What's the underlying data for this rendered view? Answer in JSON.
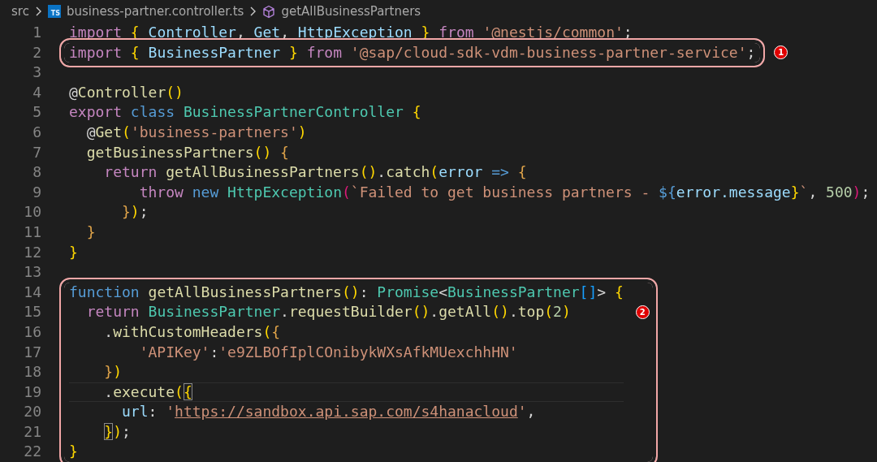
{
  "breadcrumb": [
    {
      "label": "src",
      "kind": "folder"
    },
    {
      "label": "business-partner.controller.ts",
      "kind": "file",
      "icon_text": "TS"
    },
    {
      "label": "getAllBusinessPartners",
      "kind": "symbol"
    }
  ],
  "code_groups": [
    {
      "lines": [
        {
          "number": "1",
          "tokens": [
            {
              "text": "import",
              "kind": "k"
            },
            {
              "text": " {",
              "kind": "b1"
            },
            {
              "text": " Controller",
              "kind": "v"
            },
            {
              "text": ",",
              "kind": "p"
            },
            {
              "text": " Get",
              "kind": "v"
            },
            {
              "text": ",",
              "kind": "p"
            },
            {
              "text": " HttpException",
              "kind": "v"
            },
            {
              "text": " }",
              "kind": "b1"
            },
            {
              "text": " from",
              "kind": "k"
            },
            {
              "text": " '@nestjs/common'",
              "kind": "str"
            },
            {
              "text": ";",
              "kind": "p"
            }
          ]
        }
      ]
    },
    {
      "callout": "1",
      "badge_inside": false,
      "lines": [
        {
          "number": "2",
          "tokens": [
            {
              "text": "import",
              "kind": "k"
            },
            {
              "text": " {",
              "kind": "b1"
            },
            {
              "text": " BusinessPartner",
              "kind": "v"
            },
            {
              "text": " }",
              "kind": "b1"
            },
            {
              "text": " from",
              "kind": "k"
            },
            {
              "text": " '@sap/cloud-sdk-vdm-business-partner-service'",
              "kind": "str"
            },
            {
              "text": ";",
              "kind": "p"
            }
          ]
        }
      ]
    },
    {
      "lines": [
        {
          "number": "3"
        },
        {
          "number": "4",
          "tokens": [
            {
              "text": "@",
              "kind": "p"
            },
            {
              "text": "Controller",
              "kind": "f"
            },
            {
              "text": "()",
              "kind": "b1"
            }
          ]
        },
        {
          "number": "5",
          "tokens": [
            {
              "text": "export",
              "kind": "k"
            },
            {
              "text": " class",
              "kind": "s"
            },
            {
              "text": " BusinessPartnerController",
              "kind": "t"
            },
            {
              "text": " {",
              "kind": "b1"
            }
          ]
        },
        {
          "number": "6",
          "tokens": [
            {
              "text": "  @",
              "kind": "p"
            },
            {
              "text": "Get",
              "kind": "f"
            },
            {
              "text": "(",
              "kind": "b1"
            },
            {
              "text": "'business-partners'",
              "kind": "str"
            },
            {
              "text": ")",
              "kind": "b1"
            }
          ]
        },
        {
          "number": "7",
          "tokens": [
            {
              "text": "  getBusinessPartners",
              "kind": "f"
            },
            {
              "text": "()",
              "kind": "b1"
            },
            {
              "text": " {",
              "kind": "b4"
            }
          ]
        },
        {
          "number": "8",
          "tokens": [
            {
              "text": "    return",
              "kind": "k"
            },
            {
              "text": " getAllBusinessPartners",
              "kind": "f"
            },
            {
              "text": "()",
              "kind": "b1"
            },
            {
              "text": ".",
              "kind": "p"
            },
            {
              "text": "catch",
              "kind": "f"
            },
            {
              "text": "(",
              "kind": "b1"
            },
            {
              "text": "error",
              "kind": "v"
            },
            {
              "text": " =>",
              "kind": "s"
            },
            {
              "text": " {",
              "kind": "b4"
            }
          ]
        },
        {
          "number": "9",
          "tokens": [
            {
              "text": "        throw",
              "kind": "k"
            },
            {
              "text": " new",
              "kind": "s"
            },
            {
              "text": " HttpException",
              "kind": "t"
            },
            {
              "text": "(",
              "kind": "b2"
            },
            {
              "text": "`Failed to get business partners - ",
              "kind": "str"
            },
            {
              "text": "${",
              "kind": "s"
            },
            {
              "text": "error.message",
              "kind": "v"
            },
            {
              "text": "}",
              "kind": "b1"
            },
            {
              "text": "`",
              "kind": "str"
            },
            {
              "text": ",",
              "kind": "p"
            },
            {
              "text": " 500",
              "kind": "n"
            },
            {
              "text": ")",
              "kind": "b2"
            },
            {
              "text": ";",
              "kind": "p"
            }
          ]
        },
        {
          "number": "10",
          "tokens": [
            {
              "text": "      }",
              "kind": "b4"
            },
            {
              "text": ")",
              "kind": "b1"
            },
            {
              "text": ";",
              "kind": "p"
            }
          ]
        },
        {
          "number": "11",
          "tokens": [
            {
              "text": "  }",
              "kind": "b4"
            }
          ]
        },
        {
          "number": "12",
          "tokens": [
            {
              "text": "}",
              "kind": "b1"
            }
          ]
        },
        {
          "number": "13"
        }
      ]
    },
    {
      "callout": "2",
      "badge_inside": true,
      "lines": [
        {
          "number": "14",
          "tokens": [
            {
              "text": "function",
              "kind": "s"
            },
            {
              "text": " getAllBusinessPartners",
              "kind": "f"
            },
            {
              "text": "()",
              "kind": "b1"
            },
            {
              "text": ":",
              "kind": "p"
            },
            {
              "text": " Promise",
              "kind": "t"
            },
            {
              "text": "<",
              "kind": "p"
            },
            {
              "text": "BusinessPartner",
              "kind": "t"
            },
            {
              "text": "[]",
              "kind": "b3"
            },
            {
              "text": ">",
              "kind": "p"
            },
            {
              "text": " {",
              "kind": "b1"
            }
          ]
        },
        {
          "number": "15",
          "tokens": [
            {
              "text": "  return",
              "kind": "k"
            },
            {
              "text": " BusinessPartner",
              "kind": "t"
            },
            {
              "text": ".",
              "kind": "p"
            },
            {
              "text": "requestBuilder",
              "kind": "f"
            },
            {
              "text": "()",
              "kind": "b1"
            },
            {
              "text": ".",
              "kind": "p"
            },
            {
              "text": "getAll",
              "kind": "f"
            },
            {
              "text": "()",
              "kind": "b1"
            },
            {
              "text": ".",
              "kind": "p"
            },
            {
              "text": "top",
              "kind": "f"
            },
            {
              "text": "(",
              "kind": "b1"
            },
            {
              "text": "2",
              "kind": "n"
            },
            {
              "text": ")",
              "kind": "b1"
            }
          ]
        },
        {
          "number": "16",
          "tokens": [
            {
              "text": "    .",
              "kind": "p"
            },
            {
              "text": "withCustomHeaders",
              "kind": "f"
            },
            {
              "text": "(",
              "kind": "b1"
            },
            {
              "text": "{",
              "kind": "b4"
            }
          ]
        },
        {
          "number": "17",
          "tokens": [
            {
              "text": "        'APIKey'",
              "kind": "str"
            },
            {
              "text": ":",
              "kind": "p"
            },
            {
              "text": "'e9ZLBOfIplCOnibykWXsAfkMUexchhHN'",
              "kind": "str"
            }
          ]
        },
        {
          "number": "18",
          "tokens": [
            {
              "text": "    }",
              "kind": "b4"
            },
            {
              "text": ")",
              "kind": "b1"
            }
          ]
        },
        {
          "number": "19",
          "current": true,
          "tokens": [
            {
              "text": "    .",
              "kind": "p"
            },
            {
              "text": "execute",
              "kind": "f"
            },
            {
              "text": "(",
              "kind": "b1"
            },
            {
              "text": "{",
              "kind": "m"
            }
          ]
        },
        {
          "number": "20",
          "tokens": [
            {
              "text": "      url",
              "kind": "v"
            },
            {
              "text": ":",
              "kind": "p"
            },
            {
              "text": " '",
              "kind": "str"
            },
            {
              "text": "https://sandbox.api.sap.com/s4hanacloud",
              "kind": "u"
            },
            {
              "text": "'",
              "kind": "str"
            },
            {
              "text": ",",
              "kind": "p"
            }
          ]
        },
        {
          "number": "21",
          "tokens": [
            {
              "text": "    }",
              "kind": "m"
            },
            {
              "text": ")",
              "kind": "b1"
            },
            {
              "text": ";",
              "kind": "p"
            }
          ]
        },
        {
          "number": "22",
          "tokens": [
            {
              "text": "}",
              "kind": "b1"
            }
          ]
        }
      ]
    }
  ]
}
